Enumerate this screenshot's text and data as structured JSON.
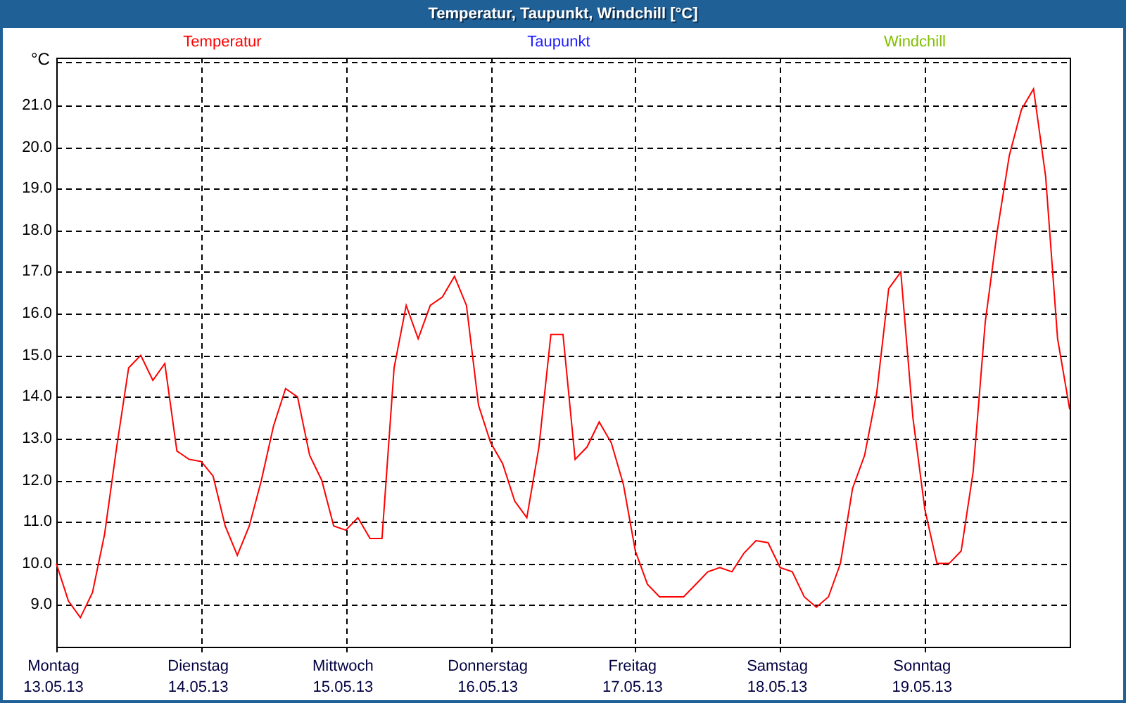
{
  "window": {
    "title": "Temperatur, Taupunkt, Windchill [°C]"
  },
  "legend": [
    {
      "label": "Taupunkt",
      "color": "#2020ff"
    },
    {
      "label": "Windchill",
      "color": "#80c000"
    }
  ],
  "chart": {
    "day_labels": [
      "Montag",
      "Dienstag",
      "Mittwoch",
      "Donnerstag",
      "Freitag",
      "Samstag",
      "Sonntag"
    ],
    "chart_data": {
      "type": "line",
      "grid": true,
      "ylabel": "°C",
      "ylim": [
        8,
        22.15
      ],
      "yticks": [
        {
          "value": 9,
          "label": "9.0"
        },
        {
          "value": 10,
          "label": "10.0"
        },
        {
          "value": 11,
          "label": "11.0"
        },
        {
          "value": 12,
          "label": "12.0"
        },
        {
          "value": 13,
          "label": "13.0"
        },
        {
          "value": 14,
          "label": "14.0"
        },
        {
          "value": 15,
          "label": "15.0"
        },
        {
          "value": 16,
          "label": "16.0"
        },
        {
          "value": 17,
          "label": "17.0"
        },
        {
          "value": 18,
          "label": "18.0"
        },
        {
          "value": 19,
          "label": "19.0"
        },
        {
          "value": 20,
          "label": "20.0"
        },
        {
          "value": 21,
          "label": "21.0"
        }
      ],
      "categories": [
        "13.05.13",
        null,
        null,
        null,
        null,
        null,
        null,
        null,
        null,
        null,
        null,
        null,
        "14.05.13",
        null,
        null,
        null,
        null,
        null,
        null,
        null,
        null,
        null,
        null,
        null,
        "15.05.13",
        null,
        null,
        null,
        null,
        null,
        null,
        null,
        null,
        null,
        null,
        null,
        "16.05.13",
        null,
        null,
        null,
        null,
        null,
        null,
        null,
        null,
        null,
        null,
        null,
        "17.05.13",
        null,
        null,
        null,
        null,
        null,
        null,
        null,
        null,
        null,
        null,
        null,
        "18.05.13",
        null,
        null,
        null,
        null,
        null,
        null,
        null,
        null,
        null,
        null,
        null,
        "19.05.13",
        null,
        null,
        null,
        null,
        null,
        null,
        null,
        null,
        null,
        null,
        null,
        null
      ],
      "series": [
        {
          "name": "Temperatur",
          "color": "#ff0000",
          "values": [
            10.0,
            9.1,
            8.7,
            9.3,
            10.7,
            12.8,
            14.7,
            15.0,
            14.4,
            14.8,
            12.7,
            12.5,
            12.45,
            12.1,
            10.9,
            10.2,
            10.9,
            12.0,
            13.3,
            14.2,
            14.0,
            12.6,
            12.0,
            10.9,
            10.8,
            11.1,
            10.6,
            10.6,
            14.7,
            16.2,
            15.4,
            16.2,
            16.4,
            16.9,
            16.2,
            13.8,
            12.9,
            12.4,
            11.5,
            11.1,
            12.8,
            15.5,
            15.5,
            12.5,
            12.8,
            13.4,
            12.9,
            11.9,
            10.3,
            9.5,
            9.2,
            9.2,
            9.2,
            9.5,
            9.8,
            9.9,
            9.8,
            10.25,
            10.55,
            10.5,
            9.9,
            9.8,
            9.2,
            8.95,
            9.2,
            10.0,
            11.8,
            12.6,
            14.1,
            16.6,
            17.0,
            13.5,
            11.3,
            10.0,
            10.0,
            10.3,
            12.2,
            15.8,
            18.0,
            19.8,
            20.9,
            21.4,
            19.3,
            15.4,
            13.7
          ]
        }
      ]
    }
  }
}
